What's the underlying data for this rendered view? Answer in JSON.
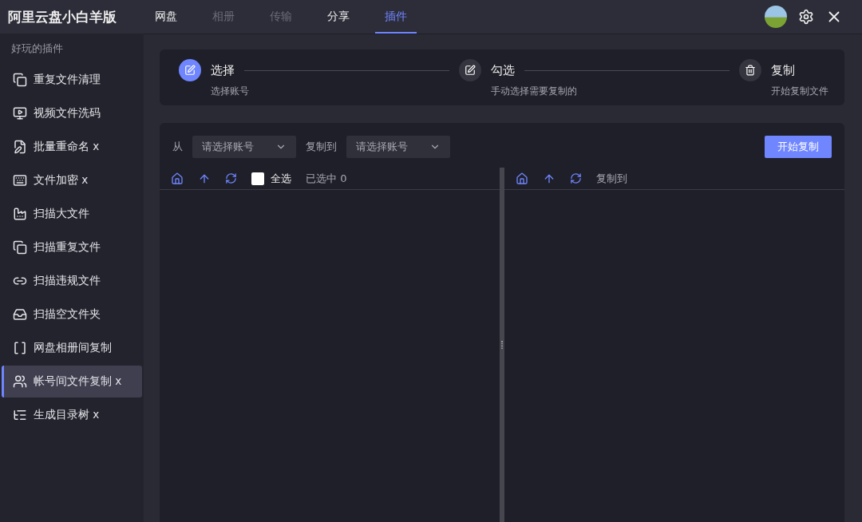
{
  "app_title": "阿里云盘小白羊版",
  "tabs": [
    {
      "label": "网盘",
      "selected": false,
      "disabled": false
    },
    {
      "label": "相册",
      "selected": false,
      "disabled": true
    },
    {
      "label": "传输",
      "selected": false,
      "disabled": true
    },
    {
      "label": "分享",
      "selected": false,
      "disabled": false
    },
    {
      "label": "插件",
      "selected": true,
      "disabled": false
    }
  ],
  "sidebar": {
    "heading": "好玩的插件",
    "items": [
      {
        "label": "重复文件清理",
        "selected": false
      },
      {
        "label": "视频文件洗码",
        "selected": false
      },
      {
        "label": "批量重命名 x",
        "selected": false
      },
      {
        "label": "文件加密 x",
        "selected": false
      },
      {
        "label": "扫描大文件",
        "selected": false
      },
      {
        "label": "扫描重复文件",
        "selected": false
      },
      {
        "label": "扫描违规文件",
        "selected": false
      },
      {
        "label": "扫描空文件夹",
        "selected": false
      },
      {
        "label": "网盘相册间复制",
        "selected": false
      },
      {
        "label": "帐号间文件复制 x",
        "selected": true
      },
      {
        "label": "生成目录树 x",
        "selected": false
      }
    ]
  },
  "steps": [
    {
      "title": "选择",
      "description": "选择账号",
      "active": true
    },
    {
      "title": "勾选",
      "description": "手动选择需要复制的",
      "active": false
    },
    {
      "title": "复制",
      "description": "开始复制文件",
      "active": false
    }
  ],
  "copy_form": {
    "from_label": "从",
    "from_placeholder": "请选择账号",
    "to_label": "复制到",
    "to_placeholder": "请选择账号",
    "start_button": "开始复制"
  },
  "left_pane": {
    "select_all": "全选",
    "select_all_checked": false,
    "selected_count": "已选中 0"
  },
  "right_pane": {
    "label": "复制到"
  }
}
